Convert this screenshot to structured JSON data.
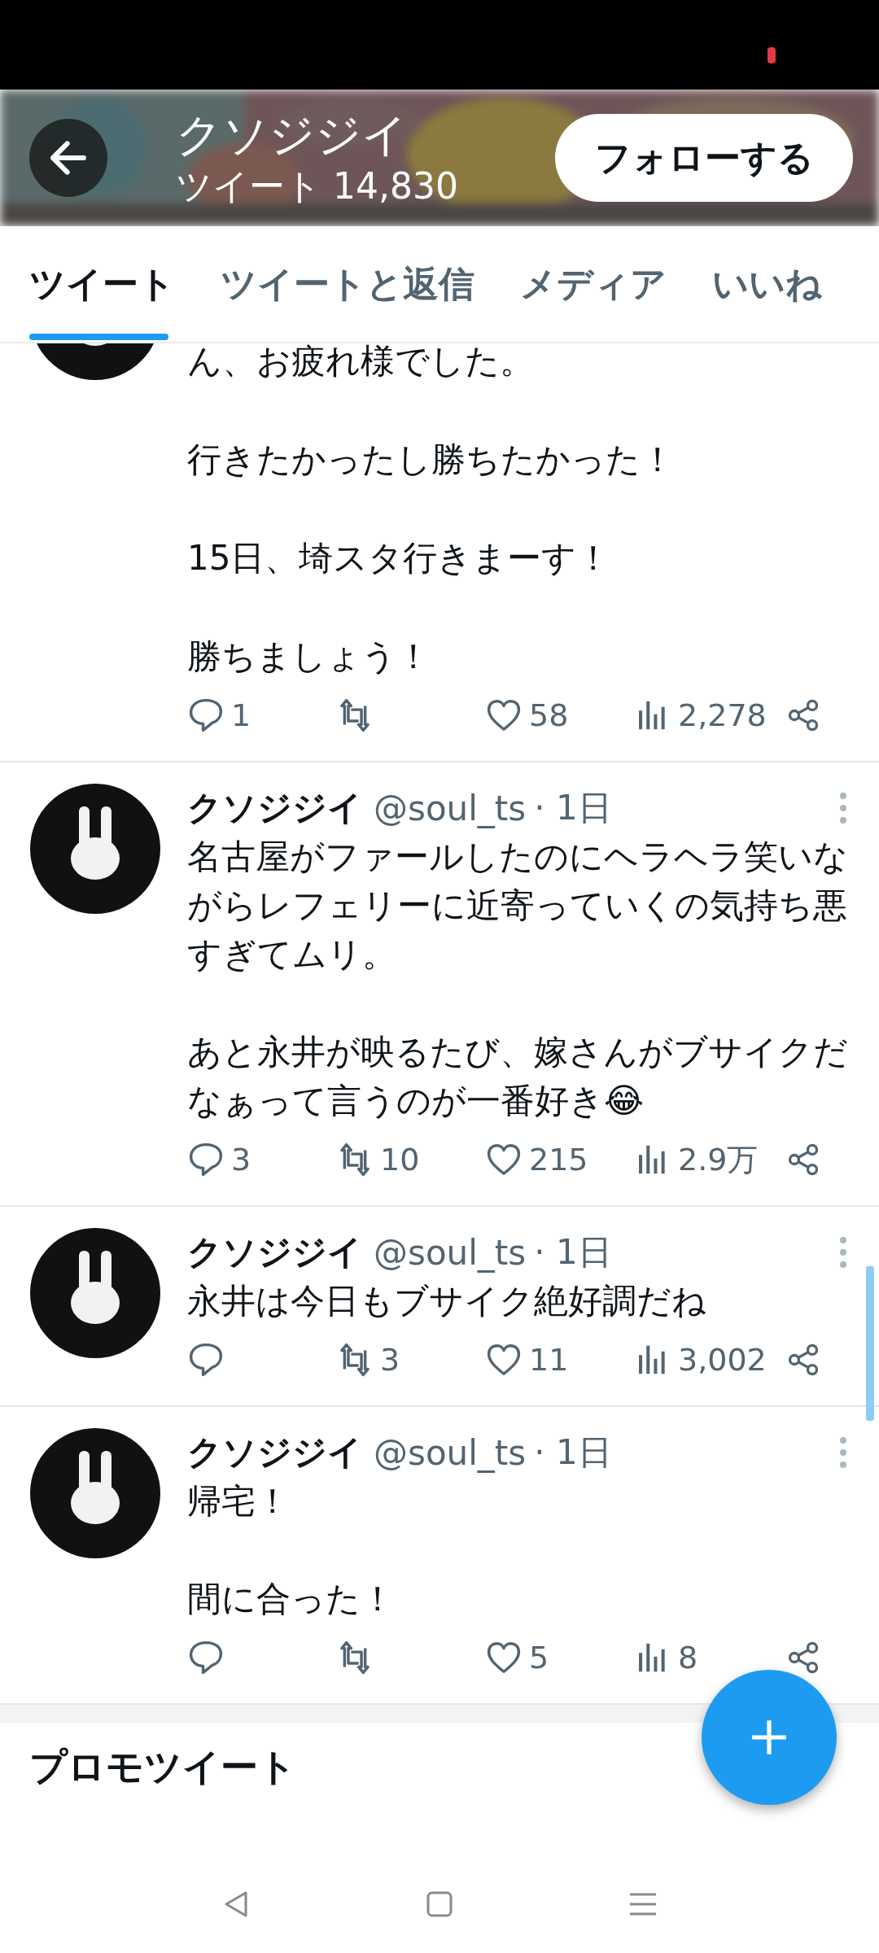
{
  "header": {
    "title": "クソジジイ",
    "subtitle": "ツイート 14,830",
    "follow_button": "フォローする"
  },
  "tabs": [
    {
      "label": "ツイート",
      "selected": true
    },
    {
      "label": "ツイートと返信",
      "selected": false
    },
    {
      "label": "メディア",
      "selected": false
    },
    {
      "label": "いいね",
      "selected": false
    }
  ],
  "tweets": [
    {
      "paragraphs": [
        "ん、お疲れ様でした。",
        "行きたかったし勝ちたかった！",
        "15日、埼スタ行きまーす！",
        "勝ちましょう！"
      ],
      "replies": "1",
      "likes": "58",
      "views": "2,278"
    },
    {
      "name": "クソジジイ",
      "handle": "@soul_ts",
      "time": "· 1日",
      "paragraphs": [
        "名古屋がファールしたのにヘラヘラ笑いながらレフェリーに近寄っていくの気持ち悪すぎてムリ。",
        "あと永井が映るたび、嫁さんがブサイクだなぁって言うのが一番好き😂"
      ],
      "replies": "3",
      "retweets": "10",
      "likes": "215",
      "views": "2.9万"
    },
    {
      "name": "クソジジイ",
      "handle": "@soul_ts",
      "time": "· 1日",
      "paragraphs": [
        "永井は今日もブサイク絶好調だね"
      ],
      "retweets": "3",
      "likes": "11",
      "views": "3,002"
    },
    {
      "name": "クソジジイ",
      "handle": "@soul_ts",
      "time": "· 1日",
      "paragraphs": [
        "帰宅！",
        "間に合った！"
      ],
      "likes": "5",
      "views": "8"
    }
  ],
  "section_title": "プロモツイート"
}
